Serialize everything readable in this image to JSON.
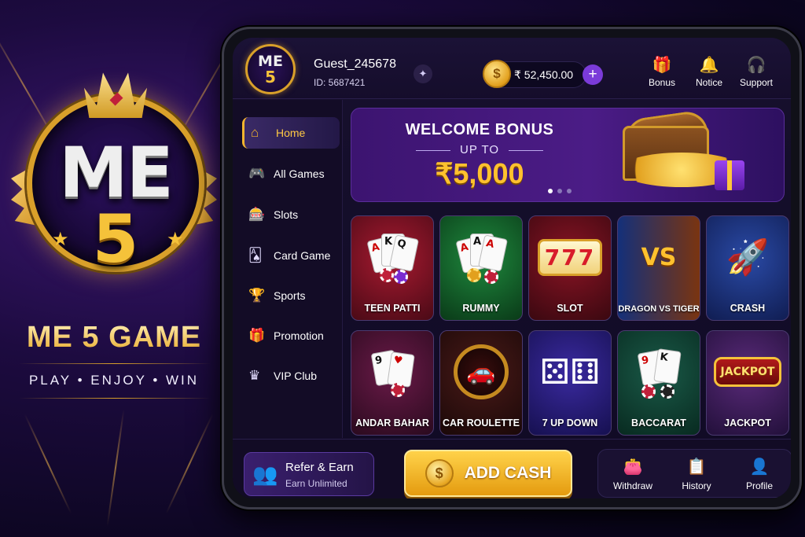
{
  "brand": {
    "logo_top": "ME",
    "logo_bottom": "5",
    "name": "ME 5 GAME",
    "tagline": "PLAY • ENJOY • WIN"
  },
  "header": {
    "logo_top": "ME",
    "logo_bottom": "5",
    "username": "Guest_245678",
    "user_id": "ID: 5687421",
    "balance": "₹ 52,450.00",
    "coin_symbol": "$",
    "add_symbol": "+",
    "buttons": [
      {
        "label": "Bonus",
        "icon": "gift-icon"
      },
      {
        "label": "Notice",
        "icon": "bell-icon"
      },
      {
        "label": "Support",
        "icon": "headset-icon"
      }
    ]
  },
  "sidebar": {
    "items": [
      {
        "label": "Home",
        "icon": "home-icon",
        "active": true
      },
      {
        "label": "All Games",
        "icon": "gamepad-icon"
      },
      {
        "label": "Slots",
        "icon": "slot-machine-icon"
      },
      {
        "label": "Card Game",
        "icon": "cards-icon"
      },
      {
        "label": "Sports",
        "icon": "trophy-icon"
      },
      {
        "label": "Promotion",
        "icon": "gift-icon"
      },
      {
        "label": "VIP Club",
        "icon": "crown-icon"
      }
    ]
  },
  "banner": {
    "title": "WELCOME BONUS",
    "subtitle": "UP TO",
    "amount": "₹5,000",
    "slides": 3,
    "active_slide": 0
  },
  "games": [
    {
      "label": "TEEN PATTI",
      "icon": "cards-chips-icon",
      "bg": "#6a1020"
    },
    {
      "label": "RUMMY",
      "icon": "cards-coins-icon",
      "bg": "#0f5a2a"
    },
    {
      "label": "SLOT",
      "icon": "slot-777-icon",
      "bg": "#5a0f1c"
    },
    {
      "label": "DRAGON VS TIGER",
      "icon": "dragon-tiger-icon",
      "bg": "#1a2a66"
    },
    {
      "label": "CRASH",
      "icon": "rocket-icon",
      "bg": "#1a2f70"
    },
    {
      "label": "ANDAR BAHAR",
      "icon": "cards-chip-icon",
      "bg": "#4a1030"
    },
    {
      "label": "CAR ROULETTE",
      "icon": "car-roulette-icon",
      "bg": "#2a0f12"
    },
    {
      "label": "7 UP DOWN",
      "icon": "dice-icon",
      "bg": "#2a1a66"
    },
    {
      "label": "BACCARAT",
      "icon": "cards-chips-icon",
      "bg": "#0f3a30"
    },
    {
      "label": "JACKPOT",
      "icon": "jackpot-icon",
      "bg": "#3a1a5a"
    }
  ],
  "game_art": {
    "slot_text": "777",
    "vs_text": "VS",
    "jackpot_text": "JACKPOT"
  },
  "bottom": {
    "refer_title": "Refer & Earn",
    "refer_sub": "Earn Unlimited",
    "add_cash": "ADD CASH",
    "buttons": [
      {
        "label": "Withdraw",
        "icon": "wallet-icon"
      },
      {
        "label": "History",
        "icon": "history-icon"
      },
      {
        "label": "Profile",
        "icon": "user-icon"
      }
    ]
  },
  "colors": {
    "accent_gold": "#f5b52e",
    "accent_purple": "#7b3bd9",
    "background": "#100a24"
  }
}
